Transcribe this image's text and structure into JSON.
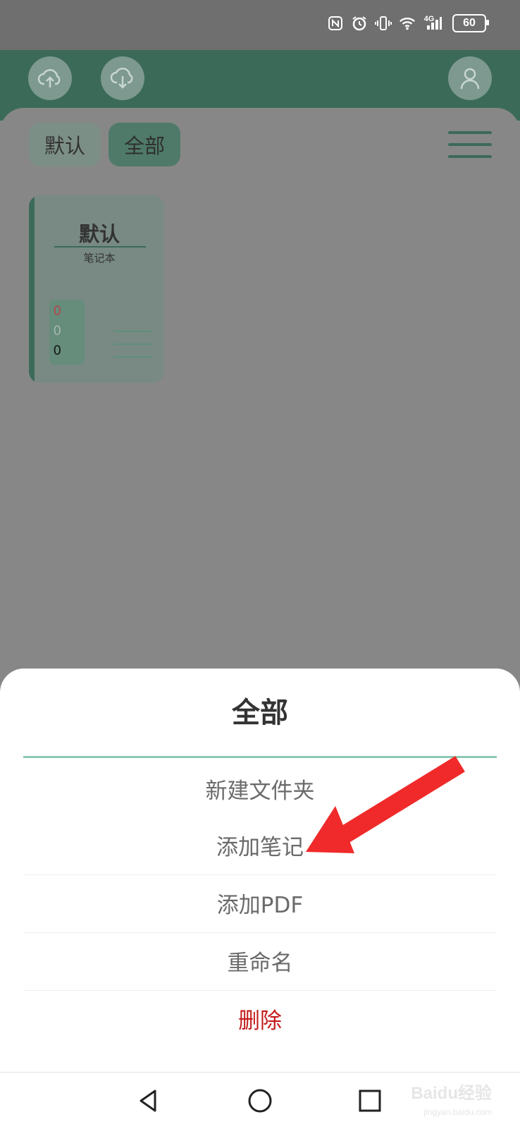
{
  "status_bar": {
    "battery": "60",
    "network": "4G",
    "icons": [
      "nfc-icon",
      "alarm-icon",
      "vibrate-icon",
      "wifi-icon",
      "signal-icon",
      "battery-icon"
    ]
  },
  "header": {
    "icons": [
      "cloud-upload-icon",
      "cloud-download-icon",
      "user-icon"
    ]
  },
  "tabs": [
    {
      "label": "默认"
    },
    {
      "label": "全部"
    }
  ],
  "notebook": {
    "title": "默认",
    "subtitle": "笔记本",
    "counts": [
      "0",
      "0",
      "0"
    ],
    "count_colors": [
      "#b44646",
      "#a7b9b1",
      "#111111"
    ]
  },
  "sheet": {
    "title": "全部",
    "options": [
      {
        "label": "新建文件夹"
      },
      {
        "label": "添加笔记"
      },
      {
        "label": "添加PDF"
      },
      {
        "label": "重命名"
      },
      {
        "label": "删除"
      }
    ]
  },
  "nav": {
    "icons": [
      "back-icon",
      "home-icon",
      "recents-icon"
    ]
  },
  "watermark": {
    "text": "Baidu经验",
    "sub": "jingyan.baidu.com"
  },
  "colors": {
    "primary": "#3c6a58",
    "accent": "#8cc8b2",
    "danger": "#c41a1a",
    "arrow": "#f02a2a"
  }
}
